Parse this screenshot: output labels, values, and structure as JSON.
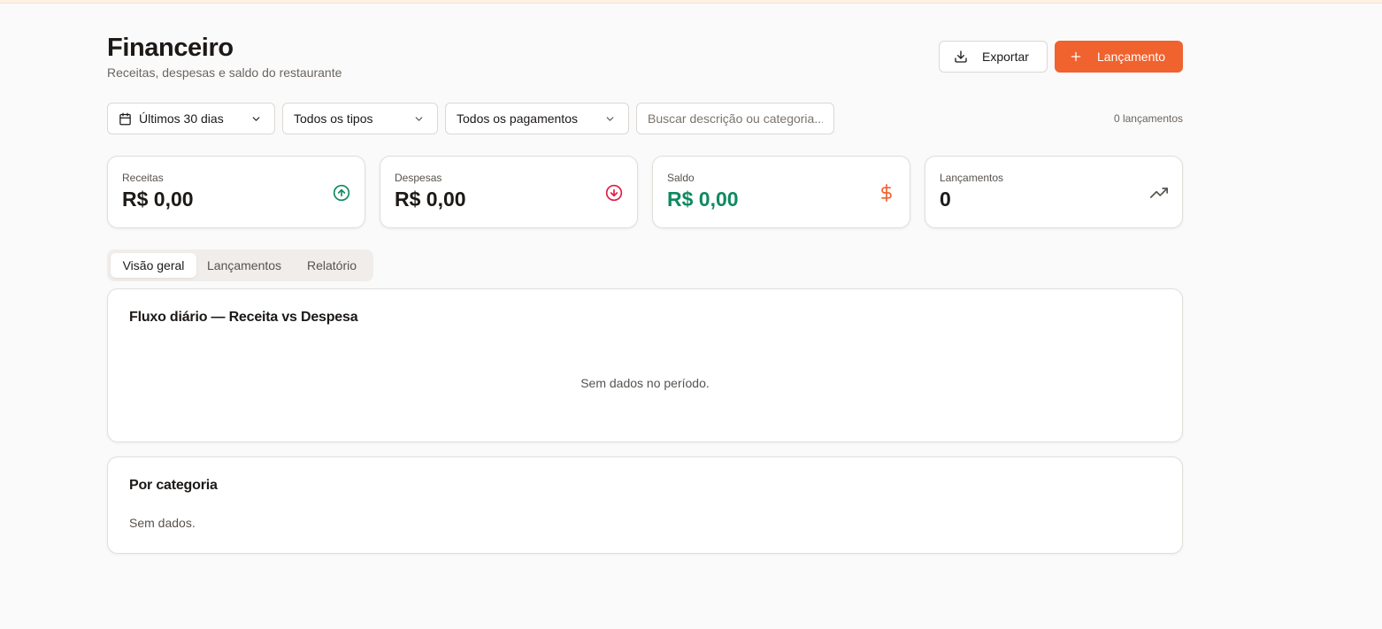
{
  "header": {
    "title": "Financeiro",
    "subtitle": "Receitas, despesas e saldo do restaurante",
    "export_label": "Exportar",
    "new_label": "Lançamento"
  },
  "filters": {
    "period": "Últimos 30 dias",
    "type": "Todos os tipos",
    "payment": "Todos os pagamentos",
    "search_placeholder": "Buscar descrição ou categoria...",
    "search_value": "",
    "count_label": "0 lançamentos"
  },
  "stats": [
    {
      "label": "Receitas",
      "value": "R$ 0,00",
      "icon": "arrow-up-circle-icon",
      "color": "#0f8a5f"
    },
    {
      "label": "Despesas",
      "value": "R$ 0,00",
      "icon": "arrow-down-circle-icon",
      "color": "#e11d48"
    },
    {
      "label": "Saldo",
      "value": "R$ 0,00",
      "icon": "dollar-sign-icon",
      "color": "#f0622e"
    },
    {
      "label": "Lançamentos",
      "value": "0",
      "icon": "trending-up-icon",
      "color": "#57534e"
    }
  ],
  "tabs": [
    {
      "label": "Visão geral",
      "active": true
    },
    {
      "label": "Lançamentos",
      "active": false
    },
    {
      "label": "Relatório",
      "active": false
    }
  ],
  "flow_card": {
    "title": "Fluxo diário — Receita vs Despesa",
    "empty_text": "Sem dados no período."
  },
  "category_card": {
    "title": "Por categoria",
    "empty_text": "Sem dados."
  },
  "colors": {
    "accent": "#f0622e",
    "positive": "#0f8a5f",
    "negative": "#e11d48"
  }
}
